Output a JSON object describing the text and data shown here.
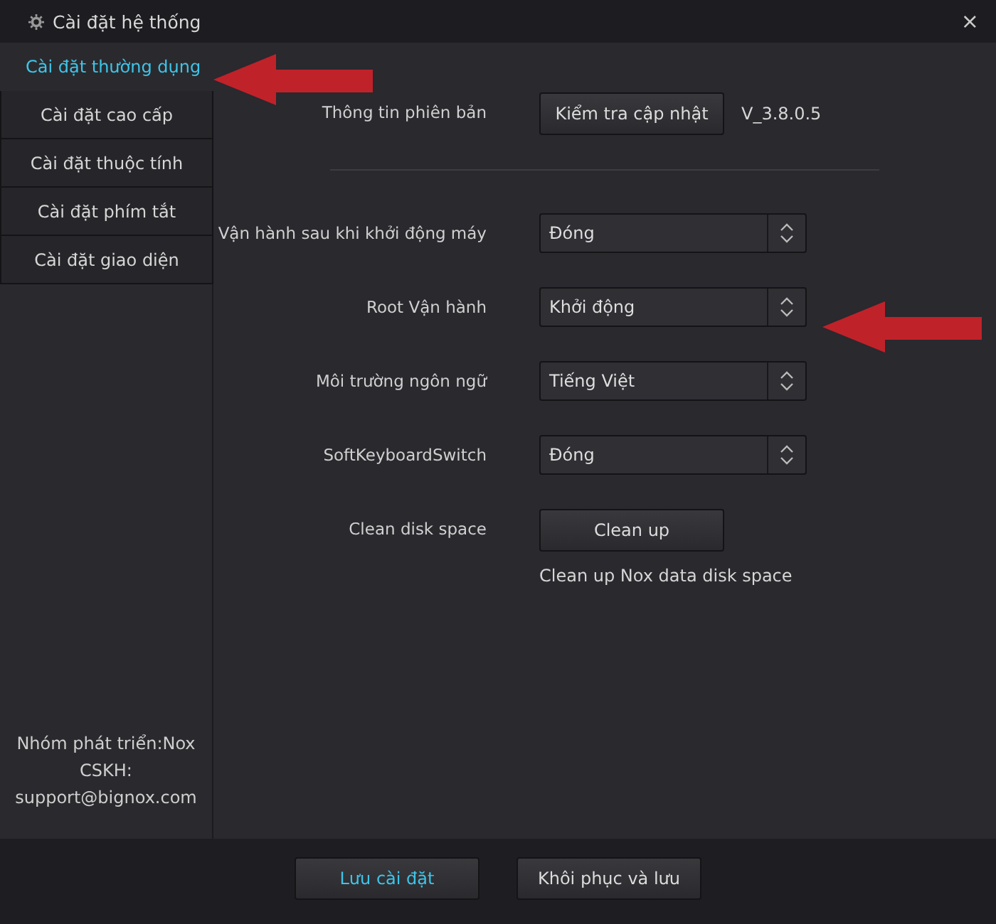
{
  "window": {
    "title": "Cài đặt hệ thống",
    "close": "×"
  },
  "sidebar": {
    "items": [
      {
        "label": "Cài đặt thường dụng",
        "selected": true
      },
      {
        "label": "Cài đặt cao cấp",
        "selected": false
      },
      {
        "label": "Cài đặt thuộc tính",
        "selected": false
      },
      {
        "label": "Cài đặt phím tắt",
        "selected": false
      },
      {
        "label": "Cài đặt giao diện",
        "selected": false
      }
    ],
    "info": [
      "Nhóm phát triển:Nox",
      "CSKH:",
      "support@bignox.com"
    ]
  },
  "settings": [
    {
      "kind": "button",
      "label": "Thông tin phiên bản",
      "button": "Kiểm tra cập nhật",
      "note": "V_3.8.0.5"
    },
    {
      "kind": "divider"
    },
    {
      "kind": "select",
      "label": "Vận hành sau khi khởi động máy",
      "value": "Đóng"
    },
    {
      "kind": "select",
      "label": "Root Vận hành",
      "value": "Khởi động"
    },
    {
      "kind": "select",
      "label": "Môi trường ngôn ngữ",
      "value": "Tiếng Việt"
    },
    {
      "kind": "select",
      "label": "SoftKeyboardSwitch",
      "value": "Đóng"
    },
    {
      "kind": "action",
      "label": "Clean disk space",
      "button": "Clean up",
      "description": "Clean up Nox data disk space"
    }
  ],
  "footer": {
    "buttons": [
      {
        "label": "Lưu cài đặt",
        "kind": "primary"
      },
      {
        "label": "Khôi phục và lưu",
        "kind": "normal"
      }
    ]
  }
}
